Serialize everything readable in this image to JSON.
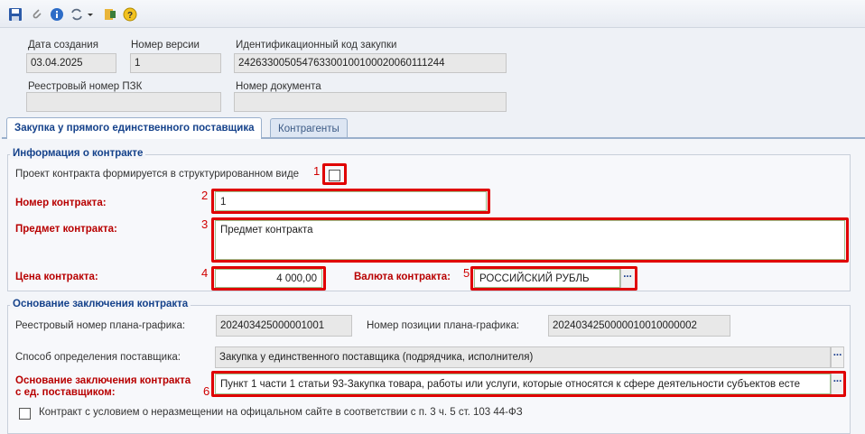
{
  "toolbar": {
    "icons": [
      "save-icon",
      "attach-icon",
      "info-icon",
      "workflow-icon",
      "chevron-down-icon",
      "export-icon",
      "help-icon"
    ]
  },
  "header": {
    "created_label": "Дата создания",
    "created_value": "03.04.2025",
    "version_label": "Номер версии",
    "version_value": "1",
    "ikz_label": "Идентификационный код закупки",
    "ikz_value": "242633005054763300100100020060111244",
    "registry_label": "Реестровый номер ПЗК",
    "registry_value": "",
    "docnum_label": "Номер документа",
    "docnum_value": ""
  },
  "tabs": [
    {
      "label": "Закупка у прямого единственного поставщика",
      "active": true
    },
    {
      "label": "Контрагенты",
      "active": false
    }
  ],
  "contract": {
    "legend": "Информация о контракте",
    "structured_label": "Проект контракта формируется в структурированном виде",
    "structured_checked": false,
    "number_label": "Номер контракта:",
    "number_value": "1",
    "subject_label": "Предмет контракта:",
    "subject_value": "Предмет контракта",
    "price_label": "Цена контракта:",
    "price_value": "4 000,00",
    "currency_label": "Валюта контракта:",
    "currency_value": "РОССИЙСКИЙ РУБЛЬ",
    "dots": "..."
  },
  "basis": {
    "legend": "Основание заключения контракта",
    "plan_reg_label": "Реестровый номер плана-графика:",
    "plan_reg_value": "202403425000001001",
    "plan_pos_label": "Номер позиции плана-графика:",
    "plan_pos_value": "2024034250000010010000002",
    "method_label": "Способ определения поставщика:",
    "method_value": "Закупка у единственного поставщика (подрядчика, исполнителя)",
    "reason_label_1": "Основание заключения контракта",
    "reason_label_2": "с ед. поставщиком:",
    "reason_value": "Пункт 1 части 1 статьи 93-Закупка товара, работы или услуги, которые относятся к сфере деятельности субъектов есте",
    "nonpublish_label": "Контракт с условием о неразмещении на офицальном сайте в соответствии с п. 3 ч. 5 ст. 103 44-ФЗ",
    "nonpublish_checked": false,
    "dots": "..."
  },
  "markers": [
    "1",
    "2",
    "3",
    "4",
    "5",
    "6"
  ],
  "colors": {
    "accent": "#15428b",
    "required": "#b80000",
    "highlight": "#e00000"
  }
}
